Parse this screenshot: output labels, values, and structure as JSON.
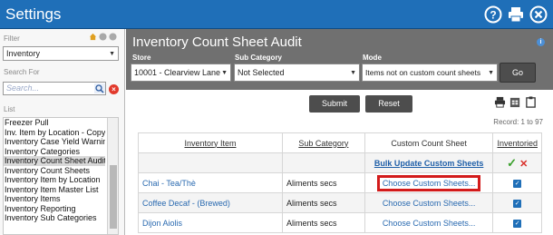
{
  "window": {
    "title": "Settings"
  },
  "sidebar": {
    "filter_label": "Filter",
    "filter_value": "Inventory",
    "search_label": "Search For",
    "search_placeholder": "Search...",
    "list_label": "List",
    "items": [
      {
        "label": "Freezer Pull"
      },
      {
        "label": "Inv. Item by Location - Copy"
      },
      {
        "label": "Inventory Case Yield Warning"
      },
      {
        "label": "Inventory Categories"
      },
      {
        "label": "Inventory Count Sheet Audit"
      },
      {
        "label": "Inventory Count Sheets"
      },
      {
        "label": "Inventory Item by Location"
      },
      {
        "label": "Inventory Item Master List"
      },
      {
        "label": "Inventory Items"
      },
      {
        "label": "Inventory Reporting"
      },
      {
        "label": "Inventory Sub Categories"
      }
    ],
    "selected_item": "Inventory Count Sheet Audit"
  },
  "main": {
    "page_title": "Inventory Count Sheet Audit",
    "store_label": "Store",
    "store_value": "10001 - Clearview Lane",
    "subcategory_label": "Sub Category",
    "subcategory_value": "Not Selected",
    "mode_label": "Mode",
    "mode_value": "Items not on custom count sheets",
    "go_label": "Go",
    "submit_label": "Submit",
    "reset_label": "Reset",
    "record_text": "Record: 1 to 97",
    "columns": {
      "item": "Inventory Item",
      "sub": "Sub Category",
      "custom": "Custom Count Sheet",
      "inventoried": "Inventoried"
    },
    "bulk_update": "Bulk Update Custom Sheets",
    "rows": [
      {
        "item": "Chai - Tea/Thè",
        "sub": "Aliments secs",
        "custom": "Choose Custom Sheets..."
      },
      {
        "item": "Coffee Decaf - (Brewed)",
        "sub": "Aliments secs",
        "custom": "Choose Custom Sheets..."
      },
      {
        "item": "Dijon Aiolis",
        "sub": "Aliments secs",
        "custom": "Choose Custom Sheets..."
      }
    ]
  },
  "colors": {
    "titlebar": "#1f6fb8",
    "header": "#707070",
    "highlight": "#d31b1b"
  },
  "icons": [
    "help-icon",
    "print-icon",
    "close-icon",
    "home-icon",
    "search-icon",
    "clear-icon",
    "info-icon",
    "print-icon",
    "export-icon",
    "clipboard-icon"
  ]
}
